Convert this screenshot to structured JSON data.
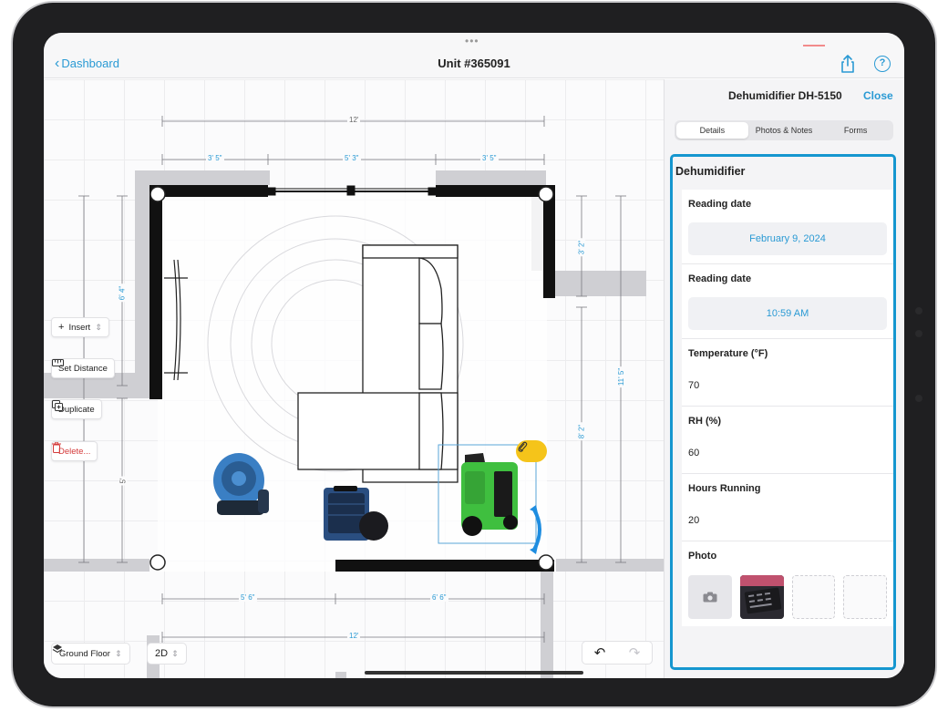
{
  "nav": {
    "back_label": "Dashboard",
    "title": "Unit #365091",
    "grabber": "•••"
  },
  "toolbar": {
    "insert_label": "Insert",
    "set_distance_label": "Set Distance",
    "duplicate_label": "Duplicate",
    "delete_label": "Delete..."
  },
  "bottom": {
    "floor_label": "Ground Floor",
    "view_label": "2D"
  },
  "dimensions": {
    "top_total": "12'",
    "top_left": "3' 5\"",
    "top_mid": "5' 3\"",
    "top_right": "3' 5\"",
    "left_upper": "6' 4\"",
    "left_lower": "5'",
    "right_upper": "3' 2\"",
    "right_mid": "8' 2\"",
    "right_total": "11' 5\"",
    "bottom_left": "5' 6\"",
    "bottom_right": "6' 6\"",
    "bottom_total": "12'"
  },
  "panel": {
    "title": "Dehumidifier DH-5150",
    "close_label": "Close",
    "tabs": [
      {
        "label": "Details",
        "active": true
      },
      {
        "label": "Photos & Notes",
        "active": false
      },
      {
        "label": "Forms",
        "active": false
      }
    ],
    "section_title": "Dehumidifier",
    "fields": {
      "reading_date_label": "Reading date",
      "reading_date_value": "February 9, 2024",
      "reading_time_label": "Reading date",
      "reading_time_value": "10:59 AM",
      "temperature_label": "Temperature (°F)",
      "temperature_value": "70",
      "rh_label": "RH (%)",
      "rh_value": "60",
      "hours_label": "Hours Running",
      "hours_value": "20",
      "photo_label": "Photo"
    }
  },
  "colors": {
    "accent": "#2a9ad4",
    "selection": "#1596cf",
    "dehumidifier": "#3fbf3f",
    "delete": "#d43a3a"
  },
  "icons": [
    "share-icon",
    "help-icon",
    "plus-icon",
    "ruler-icon",
    "duplicate-icon",
    "trash-icon",
    "layers-icon",
    "undo-icon",
    "redo-icon",
    "camera-icon",
    "paperclip-icon",
    "rotate-icon"
  ]
}
